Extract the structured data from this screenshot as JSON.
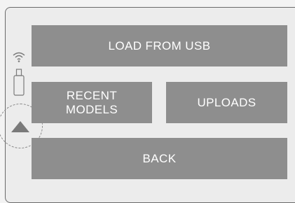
{
  "menu": {
    "load_usb_label": "LOAD FROM USB",
    "recent_models_label": "RECENT\nMODELS",
    "uploads_label": "UPLOADS",
    "back_label": "BACK"
  },
  "status_icons": [
    "wifi-icon",
    "usb-drive-icon",
    "eject-icon"
  ],
  "colors": {
    "button_bg": "#8e8e8e",
    "button_text": "#ffffff",
    "screen_bg": "#ececec",
    "icon": "#7a7a7a"
  }
}
